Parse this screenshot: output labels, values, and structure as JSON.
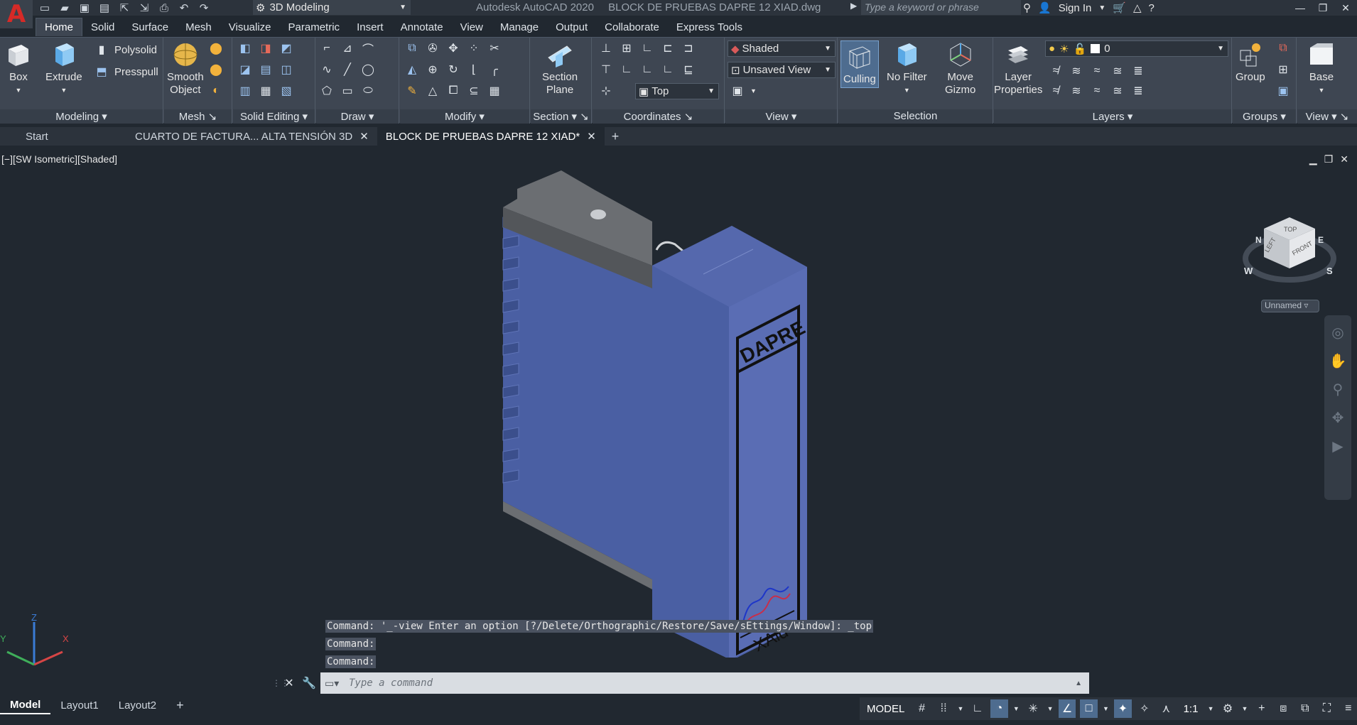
{
  "titlebar": {
    "workspace": "3D Modeling",
    "app_name": "Autodesk AutoCAD 2020",
    "file_name": "BLOCK DE PRUEBAS DAPRE 12 XIAD.dwg",
    "search_placeholder": "Type a keyword or phrase",
    "sign_in": "Sign In"
  },
  "ribbon_tabs": [
    "Home",
    "Solid",
    "Surface",
    "Mesh",
    "Visualize",
    "Parametric",
    "Insert",
    "Annotate",
    "View",
    "Manage",
    "Output",
    "Collaborate",
    "Express Tools"
  ],
  "ribbon": {
    "modeling": {
      "label": "Modeling",
      "box": "Box",
      "extrude": "Extrude",
      "polysolid": "Polysolid",
      "presspull": "Presspull"
    },
    "mesh": {
      "label": "Mesh",
      "smooth_object_1": "Smooth",
      "smooth_object_2": "Object"
    },
    "solid_editing": {
      "label": "Solid Editing"
    },
    "draw": {
      "label": "Draw"
    },
    "modify": {
      "label": "Modify"
    },
    "section": {
      "label": "Section",
      "section_plane_1": "Section",
      "section_plane_2": "Plane"
    },
    "coordinates": {
      "label": "Coordinates",
      "view_value": "Top"
    },
    "view": {
      "label": "View",
      "visual_style": "Shaded",
      "named_view": "Unsaved View"
    },
    "selection": {
      "label": "Selection",
      "culling": "Culling",
      "no_filter": "No Filter",
      "move_gizmo_1": "Move",
      "move_gizmo_2": "Gizmo"
    },
    "layers": {
      "label": "Layers",
      "layer_properties_1": "Layer",
      "layer_properties_2": "Properties",
      "current_layer": "0"
    },
    "groups": {
      "label": "Groups",
      "group": "Group"
    },
    "view2": {
      "label": "View",
      "base": "Base"
    }
  },
  "doc_tabs": {
    "start": "Start",
    "tab1": "CUARTO DE FACTURA... ALTA TENSIÓN 3D",
    "tab2": "BLOCK DE PRUEBAS DAPRE 12 XIAD*"
  },
  "viewport": {
    "label": "[−][SW Isometric][Shaded]",
    "model_brand": "DAPRE",
    "model_logo": "XAid",
    "viewcube_top": "TOP",
    "viewcube_left": "LEFT",
    "viewcube_front": "FRONT",
    "compass_n": "N",
    "compass_w": "W",
    "compass_s": "S",
    "compass_e": "E",
    "ucs_name": "Unnamed",
    "axis_x": "X",
    "axis_y": "Y",
    "axis_z": "Z"
  },
  "command": {
    "history": [
      "Command: '_-view Enter an option [?/Delete/Orthographic/Restore/Save/sEttings/Window]: _top",
      "Command:",
      "Command:"
    ],
    "placeholder": "Type a command"
  },
  "layout_tabs": [
    "Model",
    "Layout1",
    "Layout2"
  ],
  "status": {
    "space": "MODEL",
    "scale": "1:1"
  },
  "colors": {
    "accent": "#4e6c8f",
    "model_blue": "#4a5fa3",
    "background": "#212830",
    "ribbon": "#3e4652"
  }
}
